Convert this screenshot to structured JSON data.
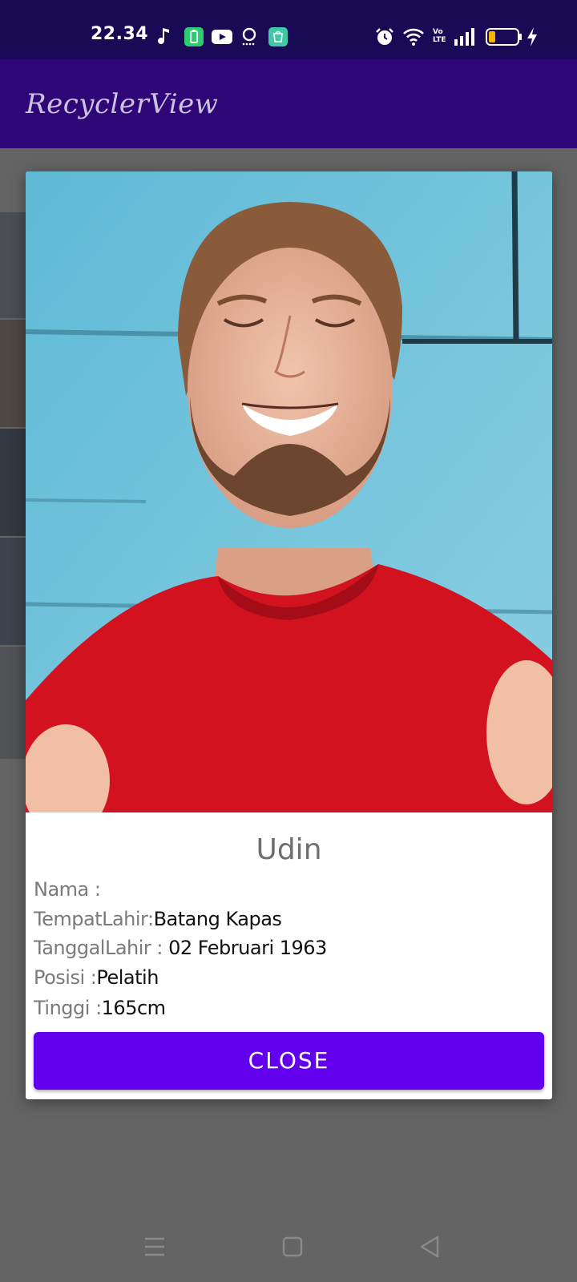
{
  "status_bar": {
    "time": "22.34",
    "left_icons": [
      "music-note-icon",
      "battery-saver-app-icon",
      "youtube-icon",
      "podcast-icon",
      "store-app-icon"
    ],
    "right_icons": [
      "alarm-icon",
      "wifi-icon",
      "volte-icon",
      "signal-icon",
      "battery-icon",
      "charging-bolt-icon"
    ],
    "volte_label": "Vo\nLTE"
  },
  "app_bar": {
    "title": "RecyclerView"
  },
  "dialog": {
    "name": "Udin",
    "details": [
      {
        "label": "Nama :",
        "value": ""
      },
      {
        "label": "TempatLahir:",
        "value": "Batang Kapas"
      },
      {
        "label": "TanggalLahir : ",
        "value": "02 Februari 1963"
      },
      {
        "label": "Posisi :",
        "value": "Pelatih"
      },
      {
        "label": "Tinggi :",
        "value": "165cm"
      }
    ],
    "close_label": "CLOSE"
  },
  "nav_bar": {
    "buttons": [
      "menu-icon",
      "home-icon",
      "back-icon"
    ]
  },
  "colors": {
    "status_bar": "#1a0a55",
    "app_bar": "#2e0677",
    "accent_button": "#6200ee"
  }
}
